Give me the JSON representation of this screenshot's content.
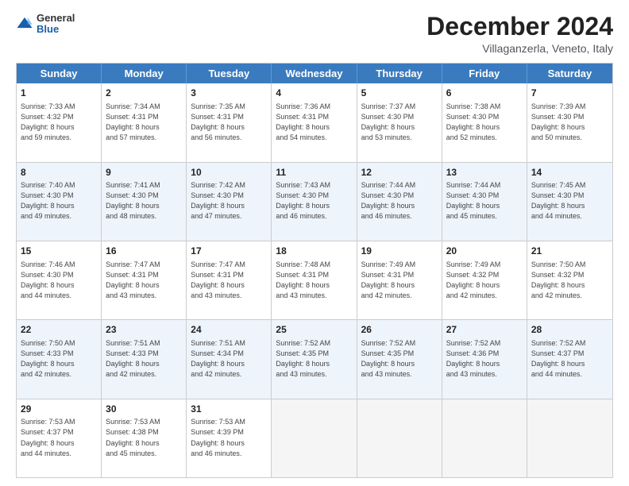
{
  "logo": {
    "general": "General",
    "blue": "Blue"
  },
  "title": "December 2024",
  "location": "Villaganzerla, Veneto, Italy",
  "header": {
    "days": [
      "Sunday",
      "Monday",
      "Tuesday",
      "Wednesday",
      "Thursday",
      "Friday",
      "Saturday"
    ]
  },
  "rows": [
    {
      "alt": false,
      "cells": [
        {
          "day": "1",
          "lines": [
            "Sunrise: 7:33 AM",
            "Sunset: 4:32 PM",
            "Daylight: 8 hours",
            "and 59 minutes."
          ]
        },
        {
          "day": "2",
          "lines": [
            "Sunrise: 7:34 AM",
            "Sunset: 4:31 PM",
            "Daylight: 8 hours",
            "and 57 minutes."
          ]
        },
        {
          "day": "3",
          "lines": [
            "Sunrise: 7:35 AM",
            "Sunset: 4:31 PM",
            "Daylight: 8 hours",
            "and 56 minutes."
          ]
        },
        {
          "day": "4",
          "lines": [
            "Sunrise: 7:36 AM",
            "Sunset: 4:31 PM",
            "Daylight: 8 hours",
            "and 54 minutes."
          ]
        },
        {
          "day": "5",
          "lines": [
            "Sunrise: 7:37 AM",
            "Sunset: 4:30 PM",
            "Daylight: 8 hours",
            "and 53 minutes."
          ]
        },
        {
          "day": "6",
          "lines": [
            "Sunrise: 7:38 AM",
            "Sunset: 4:30 PM",
            "Daylight: 8 hours",
            "and 52 minutes."
          ]
        },
        {
          "day": "7",
          "lines": [
            "Sunrise: 7:39 AM",
            "Sunset: 4:30 PM",
            "Daylight: 8 hours",
            "and 50 minutes."
          ]
        }
      ]
    },
    {
      "alt": true,
      "cells": [
        {
          "day": "8",
          "lines": [
            "Sunrise: 7:40 AM",
            "Sunset: 4:30 PM",
            "Daylight: 8 hours",
            "and 49 minutes."
          ]
        },
        {
          "day": "9",
          "lines": [
            "Sunrise: 7:41 AM",
            "Sunset: 4:30 PM",
            "Daylight: 8 hours",
            "and 48 minutes."
          ]
        },
        {
          "day": "10",
          "lines": [
            "Sunrise: 7:42 AM",
            "Sunset: 4:30 PM",
            "Daylight: 8 hours",
            "and 47 minutes."
          ]
        },
        {
          "day": "11",
          "lines": [
            "Sunrise: 7:43 AM",
            "Sunset: 4:30 PM",
            "Daylight: 8 hours",
            "and 46 minutes."
          ]
        },
        {
          "day": "12",
          "lines": [
            "Sunrise: 7:44 AM",
            "Sunset: 4:30 PM",
            "Daylight: 8 hours",
            "and 46 minutes."
          ]
        },
        {
          "day": "13",
          "lines": [
            "Sunrise: 7:44 AM",
            "Sunset: 4:30 PM",
            "Daylight: 8 hours",
            "and 45 minutes."
          ]
        },
        {
          "day": "14",
          "lines": [
            "Sunrise: 7:45 AM",
            "Sunset: 4:30 PM",
            "Daylight: 8 hours",
            "and 44 minutes."
          ]
        }
      ]
    },
    {
      "alt": false,
      "cells": [
        {
          "day": "15",
          "lines": [
            "Sunrise: 7:46 AM",
            "Sunset: 4:30 PM",
            "Daylight: 8 hours",
            "and 44 minutes."
          ]
        },
        {
          "day": "16",
          "lines": [
            "Sunrise: 7:47 AM",
            "Sunset: 4:31 PM",
            "Daylight: 8 hours",
            "and 43 minutes."
          ]
        },
        {
          "day": "17",
          "lines": [
            "Sunrise: 7:47 AM",
            "Sunset: 4:31 PM",
            "Daylight: 8 hours",
            "and 43 minutes."
          ]
        },
        {
          "day": "18",
          "lines": [
            "Sunrise: 7:48 AM",
            "Sunset: 4:31 PM",
            "Daylight: 8 hours",
            "and 43 minutes."
          ]
        },
        {
          "day": "19",
          "lines": [
            "Sunrise: 7:49 AM",
            "Sunset: 4:31 PM",
            "Daylight: 8 hours",
            "and 42 minutes."
          ]
        },
        {
          "day": "20",
          "lines": [
            "Sunrise: 7:49 AM",
            "Sunset: 4:32 PM",
            "Daylight: 8 hours",
            "and 42 minutes."
          ]
        },
        {
          "day": "21",
          "lines": [
            "Sunrise: 7:50 AM",
            "Sunset: 4:32 PM",
            "Daylight: 8 hours",
            "and 42 minutes."
          ]
        }
      ]
    },
    {
      "alt": true,
      "cells": [
        {
          "day": "22",
          "lines": [
            "Sunrise: 7:50 AM",
            "Sunset: 4:33 PM",
            "Daylight: 8 hours",
            "and 42 minutes."
          ]
        },
        {
          "day": "23",
          "lines": [
            "Sunrise: 7:51 AM",
            "Sunset: 4:33 PM",
            "Daylight: 8 hours",
            "and 42 minutes."
          ]
        },
        {
          "day": "24",
          "lines": [
            "Sunrise: 7:51 AM",
            "Sunset: 4:34 PM",
            "Daylight: 8 hours",
            "and 42 minutes."
          ]
        },
        {
          "day": "25",
          "lines": [
            "Sunrise: 7:52 AM",
            "Sunset: 4:35 PM",
            "Daylight: 8 hours",
            "and 43 minutes."
          ]
        },
        {
          "day": "26",
          "lines": [
            "Sunrise: 7:52 AM",
            "Sunset: 4:35 PM",
            "Daylight: 8 hours",
            "and 43 minutes."
          ]
        },
        {
          "day": "27",
          "lines": [
            "Sunrise: 7:52 AM",
            "Sunset: 4:36 PM",
            "Daylight: 8 hours",
            "and 43 minutes."
          ]
        },
        {
          "day": "28",
          "lines": [
            "Sunrise: 7:52 AM",
            "Sunset: 4:37 PM",
            "Daylight: 8 hours",
            "and 44 minutes."
          ]
        }
      ]
    },
    {
      "alt": false,
      "cells": [
        {
          "day": "29",
          "lines": [
            "Sunrise: 7:53 AM",
            "Sunset: 4:37 PM",
            "Daylight: 8 hours",
            "and 44 minutes."
          ]
        },
        {
          "day": "30",
          "lines": [
            "Sunrise: 7:53 AM",
            "Sunset: 4:38 PM",
            "Daylight: 8 hours",
            "and 45 minutes."
          ]
        },
        {
          "day": "31",
          "lines": [
            "Sunrise: 7:53 AM",
            "Sunset: 4:39 PM",
            "Daylight: 8 hours",
            "and 46 minutes."
          ]
        },
        {
          "day": "",
          "lines": []
        },
        {
          "day": "",
          "lines": []
        },
        {
          "day": "",
          "lines": []
        },
        {
          "day": "",
          "lines": []
        }
      ]
    }
  ]
}
